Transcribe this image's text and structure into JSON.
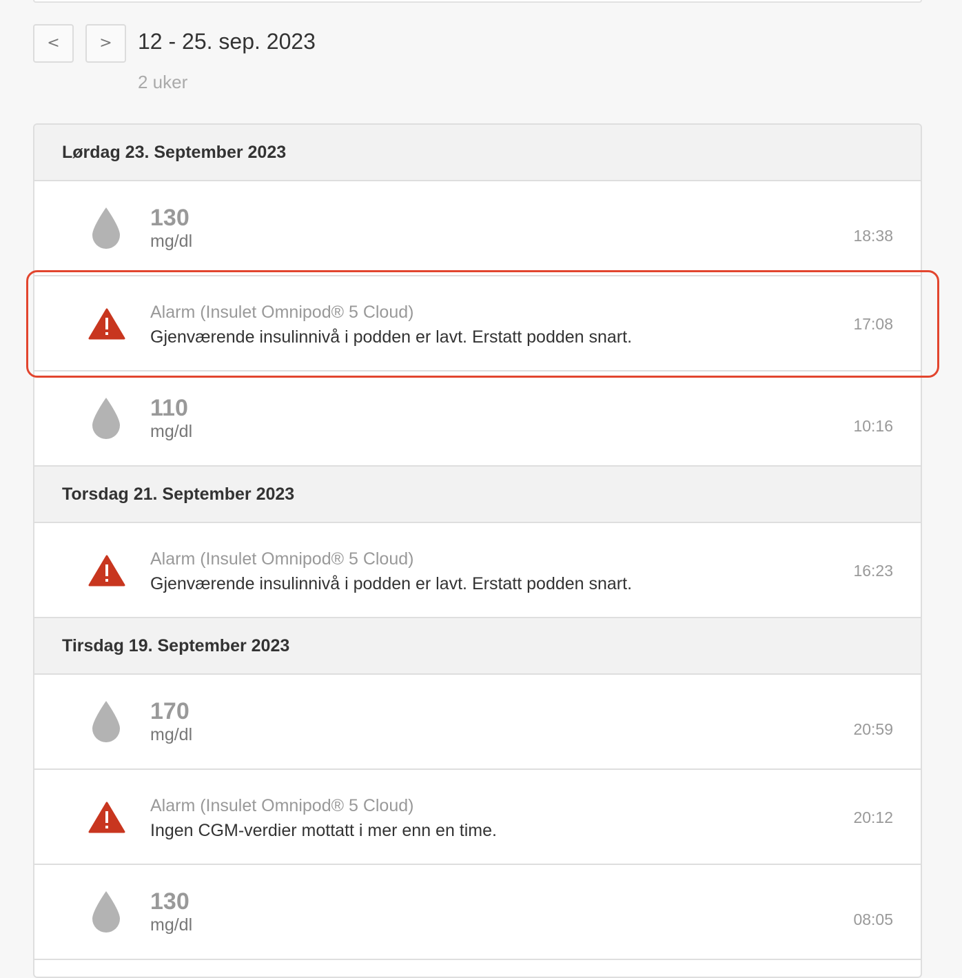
{
  "nav": {
    "prev_label": "<",
    "next_label": ">"
  },
  "range": {
    "title": "12 - 25. sep. 2023",
    "subtitle": "2 uker"
  },
  "colors": {
    "alarm": "#c8361f",
    "drop": "#b3b3b3",
    "highlight": "#e2452e"
  },
  "icons": {
    "reading": "drop-icon",
    "alarm": "warning-icon"
  },
  "days": [
    {
      "header": "Lørdag 23. September 2023",
      "entries": [
        {
          "type": "reading",
          "value": "130",
          "unit": "mg/dl",
          "time": "18:38"
        },
        {
          "type": "alarm",
          "source": "Alarm (Insulet Omnipod® 5 Cloud)",
          "message": "Gjenværende insulinnivå i podden er lavt. Erstatt podden snart.",
          "time": "17:08"
        },
        {
          "type": "reading",
          "value": "110",
          "unit": "mg/dl",
          "time": "10:16"
        }
      ]
    },
    {
      "header": "Torsdag 21. September 2023",
      "entries": [
        {
          "type": "alarm",
          "source": "Alarm (Insulet Omnipod® 5 Cloud)",
          "message": "Gjenværende insulinnivå i podden er lavt. Erstatt podden snart.",
          "time": "16:23"
        }
      ]
    },
    {
      "header": "Tirsdag 19. September 2023",
      "entries": [
        {
          "type": "reading",
          "value": "170",
          "unit": "mg/dl",
          "time": "20:59"
        },
        {
          "type": "alarm",
          "source": "Alarm (Insulet Omnipod® 5 Cloud)",
          "message": "Ingen CGM-verdier mottatt i mer enn en time.",
          "time": "20:12"
        },
        {
          "type": "reading",
          "value": "130",
          "unit": "mg/dl",
          "time": "08:05"
        }
      ]
    }
  ]
}
